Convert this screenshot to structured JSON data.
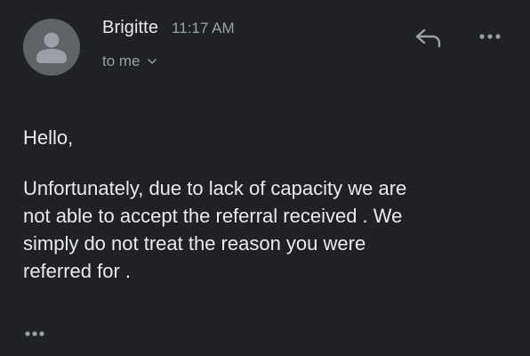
{
  "header": {
    "sender_name": "Brigitte",
    "time": "11:17 AM",
    "recipient": "to me",
    "avatar_icon": "person-icon",
    "chevron_icon": "chevron-down-icon",
    "reply_icon": "reply-icon",
    "more_icon": "more-horiz-icon"
  },
  "message": {
    "greeting": "Hello,",
    "body_lines": [
      "Unfortunately, due to lack of capacity we are",
      "not able to accept the referral received . We",
      "simply do not treat the reason you were",
      "referred for ."
    ],
    "trimmed_icon": "more-horiz-icon"
  },
  "colors": {
    "background": "#202124",
    "text_primary": "#e8eaed",
    "text_secondary": "#9aa0a6",
    "avatar_bg": "#5f6368",
    "avatar_figure": "#9aa0a6"
  }
}
